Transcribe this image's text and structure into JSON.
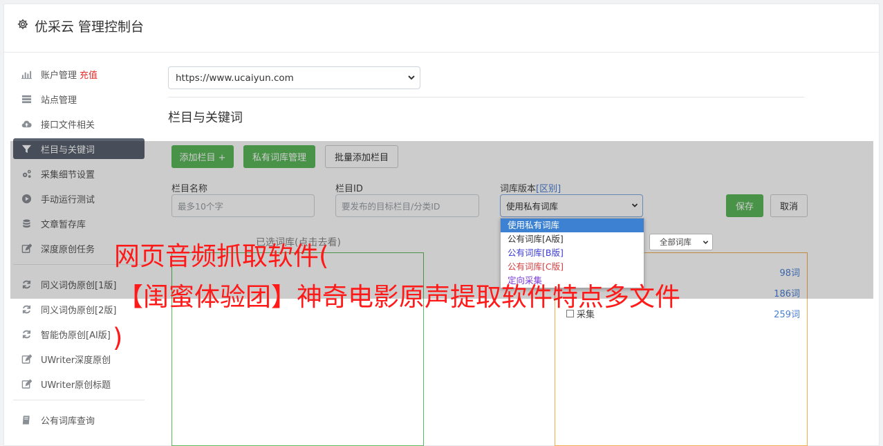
{
  "header": {
    "title": "优采云 管理控制台"
  },
  "sidebar": {
    "items": [
      {
        "label": "账户管理",
        "badge": "充值"
      },
      {
        "label": "站点管理"
      },
      {
        "label": "接口文件相关"
      },
      {
        "label": "栏目与关键词"
      },
      {
        "label": "采集细节设置"
      },
      {
        "label": "手动运行测试"
      },
      {
        "label": "文章暂存库"
      },
      {
        "label": "深度原创任务"
      },
      {
        "label": "同义词伪原创[1版]"
      },
      {
        "label": "同义词伪原创[2版]"
      },
      {
        "label": "智能伪原创[AI版]"
      },
      {
        "label": "UWriter深度原创"
      },
      {
        "label": "UWriter原创标题"
      },
      {
        "label": "公有词库查询"
      }
    ]
  },
  "main": {
    "site_select": "https://www.ucaiyun.com",
    "section_title": "栏目与关键词",
    "buttons": {
      "add_column": "添加栏目 +",
      "private_lib": "私有词库管理",
      "bulk_add": "批量添加栏目",
      "save": "保存",
      "cancel": "取消"
    },
    "form": {
      "name_label": "栏目名称",
      "name_placeholder": "最多10个字",
      "id_label": "栏目ID",
      "id_placeholder": "要发布的目标栏目/分类ID",
      "version_label": "词库版本",
      "version_link": "[区别]",
      "version_value": "使用私有词库"
    },
    "dropdown_options": [
      "使用私有词库",
      "公有词库[A版]",
      "公有词库[B版]",
      "公有词库[C版]",
      "定向采集"
    ],
    "filter_select": "全部词库",
    "left_panel_title": "已选词库(点击去看)",
    "right_panel": {
      "counts": [
        "98词",
        "186词",
        "259词"
      ],
      "checkbox_label": "采集"
    }
  },
  "watermark": {
    "line1": "网页音频抓取软件(",
    "line2": "【闺蜜体验团】神奇电影原声提取软件特点多文件",
    "line3": ")"
  }
}
